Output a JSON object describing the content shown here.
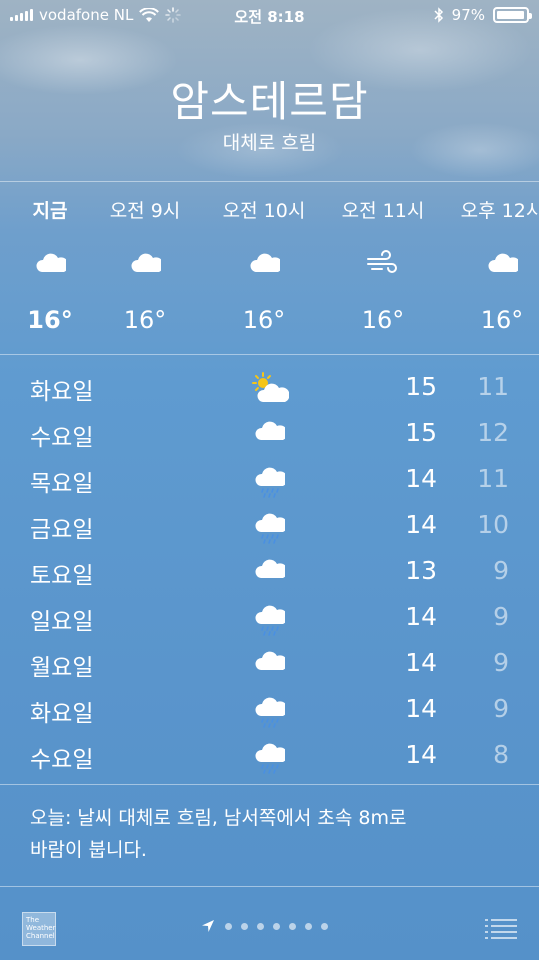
{
  "status_bar": {
    "carrier": "vodafone NL",
    "time": "오전 8:18",
    "battery": "97%",
    "icons": [
      "signal-bars-icon",
      "wifi-icon",
      "activity-spinner-icon",
      "bluetooth-icon",
      "battery-icon"
    ]
  },
  "location": {
    "city": "암스테르담",
    "condition": "대체로 흐림"
  },
  "hourly": [
    {
      "label": "지금",
      "icon": "cloud-icon",
      "temp": "16°",
      "bold": true
    },
    {
      "label": "오전 9시",
      "icon": "cloud-icon",
      "temp": "16°"
    },
    {
      "label": "오전 10시",
      "icon": "cloud-icon",
      "temp": "16°"
    },
    {
      "label": "오전 11시",
      "icon": "wind-icon",
      "temp": "16°"
    },
    {
      "label": "오후 12시",
      "icon": "cloud-icon",
      "temp": "16°"
    }
  ],
  "daily": [
    {
      "day": "화요일",
      "icon": "partly-sunny-icon",
      "high": "15",
      "low": "11"
    },
    {
      "day": "수요일",
      "icon": "cloud-icon",
      "high": "15",
      "low": "12"
    },
    {
      "day": "목요일",
      "icon": "rain-cloud-icon",
      "high": "14",
      "low": "11"
    },
    {
      "day": "금요일",
      "icon": "rain-cloud-icon",
      "high": "14",
      "low": "10"
    },
    {
      "day": "토요일",
      "icon": "cloud-icon",
      "high": "13",
      "low": "9"
    },
    {
      "day": "일요일",
      "icon": "rain-cloud-icon",
      "high": "14",
      "low": "9"
    },
    {
      "day": "월요일",
      "icon": "cloud-icon",
      "high": "14",
      "low": "9"
    },
    {
      "day": "화요일",
      "icon": "rain-cloud-icon",
      "high": "14",
      "low": "9"
    },
    {
      "day": "수요일",
      "icon": "rain-cloud-icon",
      "high": "14",
      "low": "8"
    }
  ],
  "summary": {
    "line1": "오늘: 날씨 대체로 흐림, 남서쪽에서 초속 8m로",
    "line2": "바람이 붑니다."
  },
  "footer": {
    "logo_text": [
      "The",
      "Weather",
      "Channel"
    ],
    "page_dot_count": 7,
    "icons": [
      "weather-channel-logo-icon",
      "location-arrow-icon",
      "list-icon"
    ]
  },
  "colors": {
    "background_top": "#9fb3c4",
    "background_main": "#5a95cc",
    "text": "#ffffff",
    "low_temp": "rgba(255,255,255,0.55)",
    "rain_drops": "#4a90e2",
    "sun": "#f5c518"
  }
}
